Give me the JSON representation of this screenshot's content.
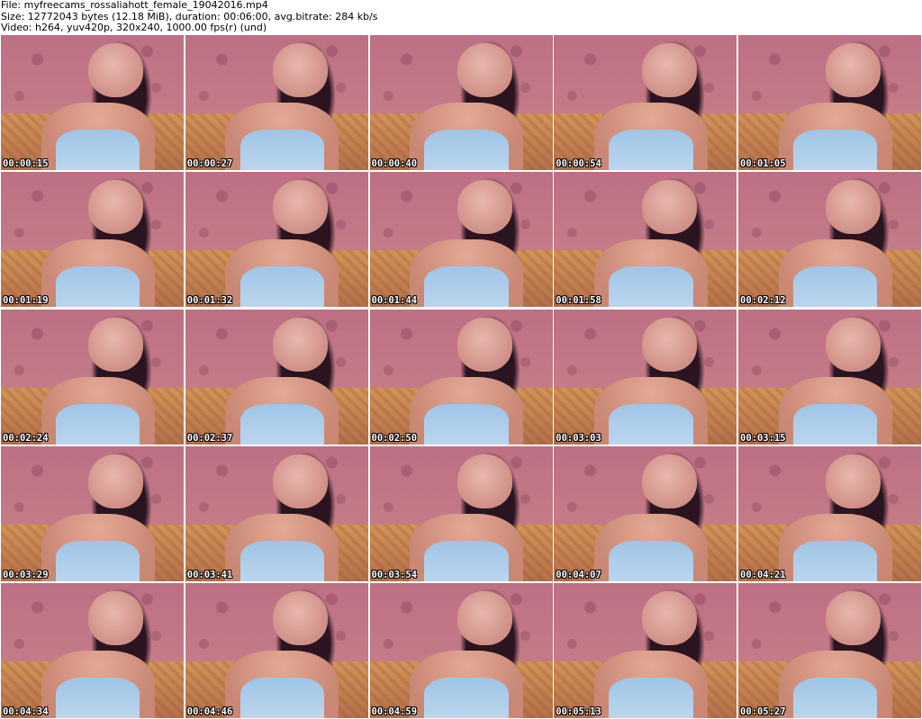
{
  "header": {
    "file_line": "File: myfreecams_rossaliahott_female_19042016.mp4",
    "size_line": "Size: 12772043 bytes (12.18 MiB), duration: 00:06:00, avg.bitrate: 284 kb/s",
    "video_line": "Video: h264, yuv420p, 320x240, 1000.00 fps(r) (und)"
  },
  "thumbnails": [
    {
      "timestamp": "00:00:15"
    },
    {
      "timestamp": "00:00:27"
    },
    {
      "timestamp": "00:00:40"
    },
    {
      "timestamp": "00:00:54"
    },
    {
      "timestamp": "00:01:05"
    },
    {
      "timestamp": "00:01:19"
    },
    {
      "timestamp": "00:01:32"
    },
    {
      "timestamp": "00:01:44"
    },
    {
      "timestamp": "00:01:58"
    },
    {
      "timestamp": "00:02:12"
    },
    {
      "timestamp": "00:02:24"
    },
    {
      "timestamp": "00:02:37"
    },
    {
      "timestamp": "00:02:50"
    },
    {
      "timestamp": "00:03:03"
    },
    {
      "timestamp": "00:03:15"
    },
    {
      "timestamp": "00:03:29"
    },
    {
      "timestamp": "00:03:41"
    },
    {
      "timestamp": "00:03:54"
    },
    {
      "timestamp": "00:04:07"
    },
    {
      "timestamp": "00:04:21"
    },
    {
      "timestamp": "00:04:34"
    },
    {
      "timestamp": "00:04:46"
    },
    {
      "timestamp": "00:04:59"
    },
    {
      "timestamp": "00:05:13"
    },
    {
      "timestamp": "00:05:27"
    }
  ]
}
